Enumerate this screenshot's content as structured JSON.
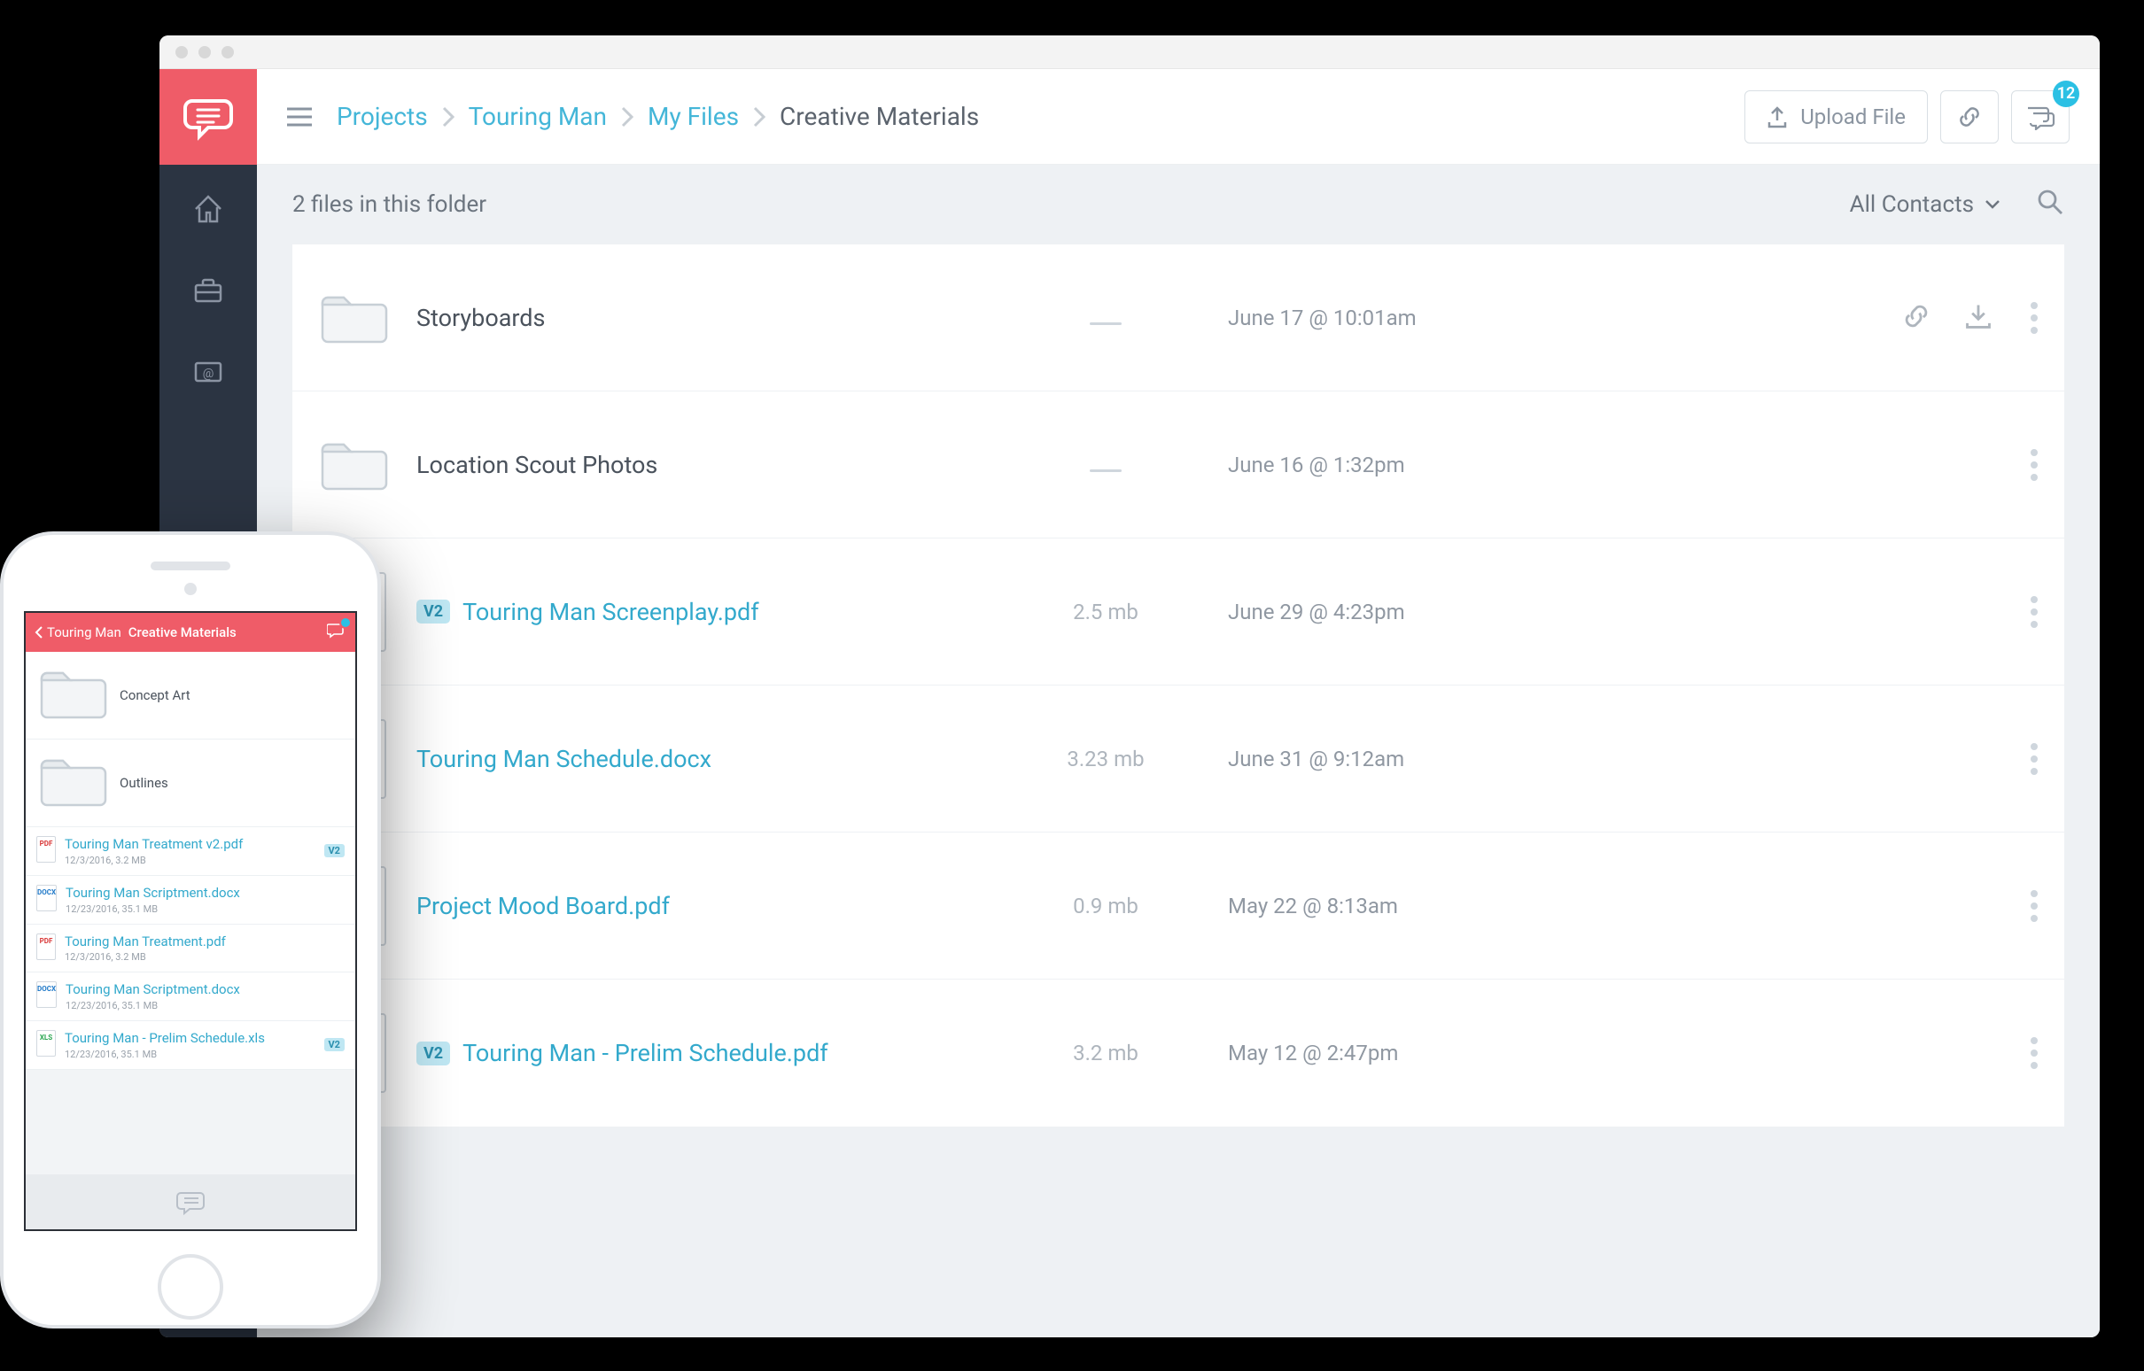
{
  "breadcrumbs": {
    "items": [
      "Projects",
      "Touring Man",
      "My Files"
    ],
    "current": "Creative Materials"
  },
  "topbar": {
    "upload_label": "Upload File",
    "chat_badge": "12"
  },
  "listbar": {
    "summary": "2 files in this folder",
    "filter": "All Contacts"
  },
  "files": [
    {
      "kind": "folder",
      "name": "Storyboards",
      "size": null,
      "date": "June 17 @ 10:01am",
      "show_actions": true
    },
    {
      "kind": "folder",
      "name": "Location Scout Photos",
      "size": null,
      "date": "June 16 @ 1:32pm",
      "show_actions": false
    },
    {
      "kind": "pdf",
      "version": "V2",
      "name": "Touring Man Screenplay.pdf",
      "size": "2.5 mb",
      "date": "June 29 @ 4:23pm"
    },
    {
      "kind": "docx",
      "name": "Touring Man Schedule.docx",
      "size": "3.23 mb",
      "date": "June 31 @ 9:12am"
    },
    {
      "kind": "pdf",
      "name": "Project Mood Board.pdf",
      "size": "0.9 mb",
      "date": "May 22 @ 8:13am"
    },
    {
      "kind": "xls",
      "version": "V2",
      "name": "Touring Man - Prelim Schedule.pdf",
      "size": "3.2 mb",
      "date": "May 12 @ 2:47pm"
    }
  ],
  "phone": {
    "back": "Touring Man",
    "title": "Creative Materials",
    "items": [
      {
        "kind": "folder",
        "name": "Concept Art"
      },
      {
        "kind": "folder",
        "name": "Outlines"
      },
      {
        "kind": "pdf",
        "name": "Touring Man Treatment v2.pdf",
        "meta": "12/3/2016, 3.2 MB",
        "version": "V2"
      },
      {
        "kind": "docx",
        "name": "Touring Man Scriptment.docx",
        "meta": "12/23/2016, 35.1 MB"
      },
      {
        "kind": "pdf",
        "name": "Touring Man Treatment.pdf",
        "meta": "12/3/2016, 3.2 MB"
      },
      {
        "kind": "docx",
        "name": "Touring Man Scriptment.docx",
        "meta": "12/23/2016, 35.1 MB"
      },
      {
        "kind": "xls",
        "name": "Touring Man - Prelim Schedule.xls",
        "meta": "12/23/2016, 35.1 MB",
        "version": "V2"
      }
    ]
  }
}
